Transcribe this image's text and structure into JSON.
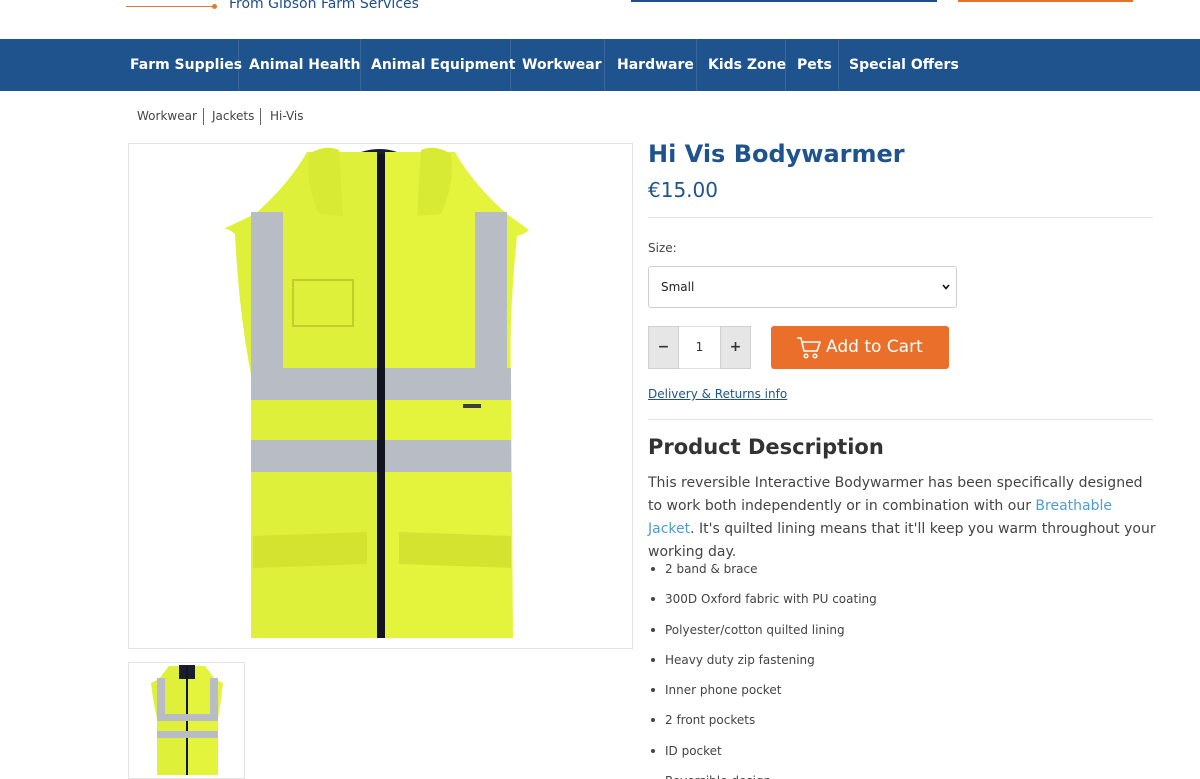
{
  "header": {
    "tagline": "From Gibson Farm Services"
  },
  "nav": {
    "items": [
      "Farm Supplies",
      "Animal Health",
      "Animal Equipment",
      "Workwear",
      "Hardware",
      "Kids Zone",
      "Pets",
      "Special Offers"
    ]
  },
  "breadcrumb": [
    "Workwear",
    "Jackets",
    "Hi-Vis"
  ],
  "product": {
    "title": "Hi Vis Bodywarmer",
    "price": "€15.00",
    "size_label": "Size:",
    "size_selected": "Small",
    "quantity": "1",
    "minus_label": "−",
    "plus_label": "+",
    "add_to_cart_label": "Add to Cart",
    "delivery_link": "Delivery & Returns info"
  },
  "description": {
    "heading": "Product Description",
    "text_before_link": "This reversible Interactive Bodywarmer has been specifically designed to work both independently or in combination with our ",
    "link_text": "Breathable Jacket",
    "text_after_link": ". It's quilted lining means that it'll keep you warm throughout your working day.",
    "features": [
      "2 band & brace",
      "300D Oxford fabric with PU coating",
      "Polyester/cotton quilted lining",
      "Heavy duty zip fastening",
      "Inner phone pocket",
      "2 front pockets",
      "ID pocket",
      "Reversible design"
    ]
  },
  "icons": {
    "cart": "shopping-cart-icon",
    "select_arrow": "chevron-down-icon"
  },
  "colors": {
    "brand_blue": "#1f538d",
    "accent_orange": "#e96f2a",
    "hivis_yellow": "#e2f23a",
    "link_blue": "#4d9cd6"
  }
}
